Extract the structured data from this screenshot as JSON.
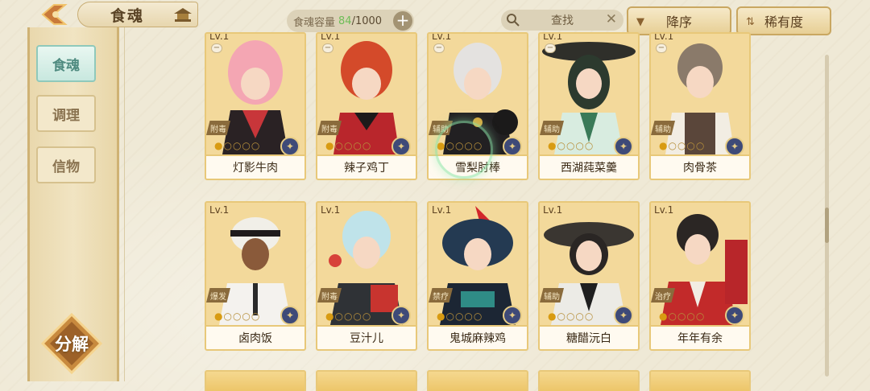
{
  "header": {
    "title": "食魂",
    "capacity_label": "食魂容量",
    "capacity_current": "84",
    "capacity_max": "/1000",
    "capacity_add": "+",
    "search_placeholder": "查找",
    "sort_order": "降序",
    "sort_rarity": "稀有度"
  },
  "sidebar": {
    "tabs": [
      {
        "label": "食魂",
        "active": true
      },
      {
        "label": "调理",
        "active": false
      },
      {
        "label": "信物",
        "active": false
      }
    ],
    "decompose_label": "分解"
  },
  "colors": {
    "background": "#efe9d6",
    "card_gold": "#ecc466",
    "accent_teal": "#8fc9bb",
    "capacity_green": "#6fbe58"
  },
  "cards_row1": [
    {
      "level": "Lv.1",
      "type": "附毒",
      "name": "灯影牛肉"
    },
    {
      "level": "Lv.1",
      "type": "附毒",
      "name": "辣子鸡丁"
    },
    {
      "level": "Lv.1",
      "type": "辅助",
      "name": "雪梨肘棒"
    },
    {
      "level": "Lv.1",
      "type": "辅助",
      "name": "西湖莼菜羹"
    },
    {
      "level": "Lv.1",
      "type": "辅助",
      "name": "肉骨茶"
    }
  ],
  "cards_row2": [
    {
      "level": "Lv.1",
      "type": "爆发",
      "name": "卤肉饭"
    },
    {
      "level": "Lv.1",
      "type": "附毒",
      "name": "豆汁儿"
    },
    {
      "level": "Lv.1",
      "type": "禁疗",
      "name": "鬼城麻辣鸡"
    },
    {
      "level": "Lv.1",
      "type": "辅助",
      "name": "糖醋沅白"
    },
    {
      "level": "Lv.1",
      "type": "治疗",
      "name": "年年有余"
    }
  ]
}
